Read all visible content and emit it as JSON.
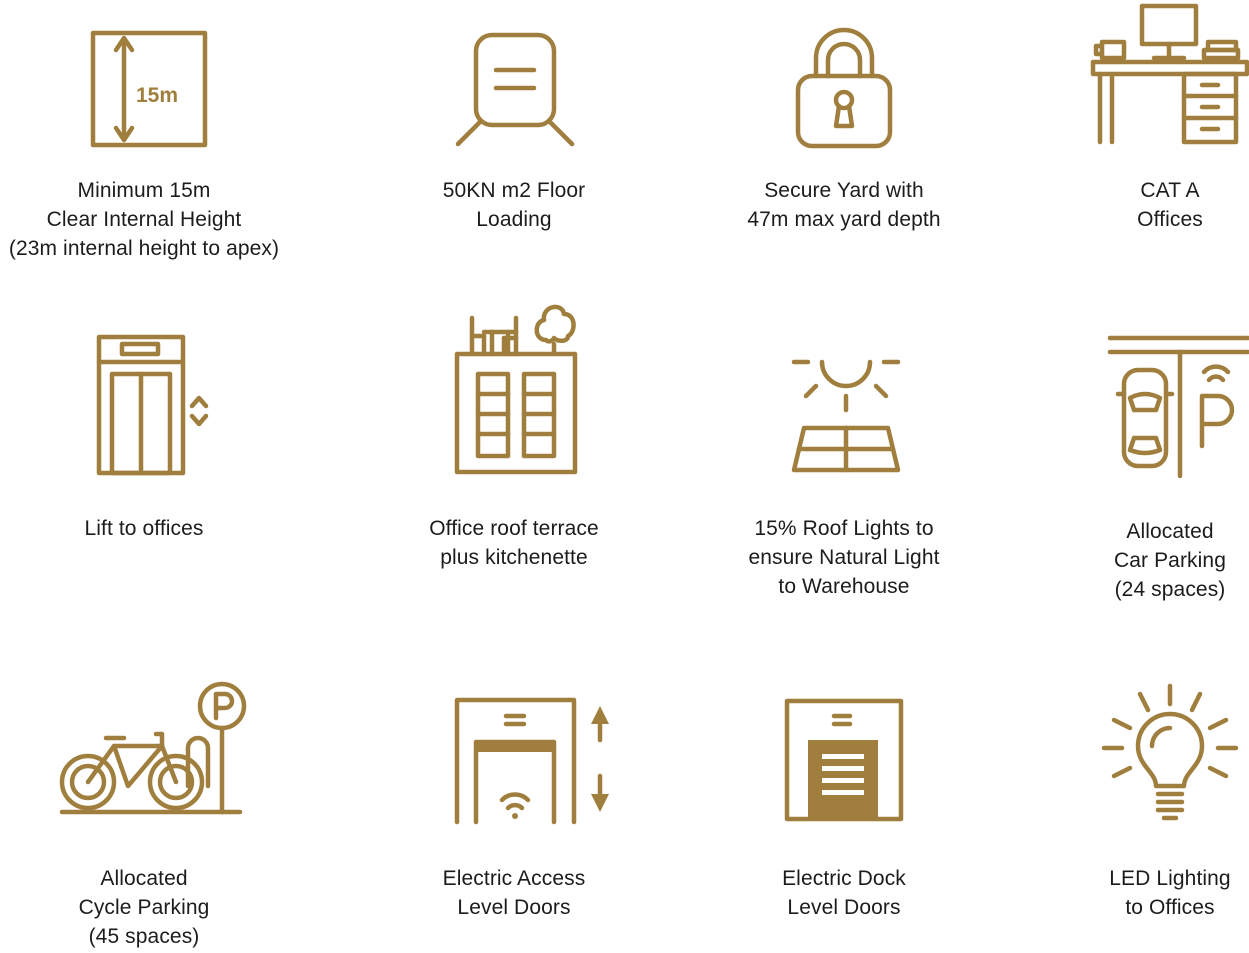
{
  "accent_color": "#a07f3e",
  "features": [
    {
      "icon": "ruler-height-icon",
      "icon_text": "15m",
      "lines": [
        "Minimum 15m",
        "Clear Internal Height",
        "(23m internal height to apex)"
      ]
    },
    {
      "icon": "floor-loading-icon",
      "lines": [
        "50KN m2 Floor",
        "Loading"
      ]
    },
    {
      "icon": "padlock-icon",
      "lines": [
        "Secure Yard with",
        "47m max yard depth"
      ]
    },
    {
      "icon": "office-desk-icon",
      "lines": [
        "CAT A",
        "Offices"
      ]
    },
    {
      "icon": "lift-icon",
      "lines": [
        "Lift to offices"
      ]
    },
    {
      "icon": "roof-terrace-icon",
      "lines": [
        "Office roof terrace",
        "plus kitchenette"
      ]
    },
    {
      "icon": "roof-light-icon",
      "lines": [
        "15% Roof Lights to",
        "ensure Natural Light",
        "to Warehouse"
      ]
    },
    {
      "icon": "car-parking-icon",
      "icon_text": "P",
      "lines": [
        "Allocated",
        "Car Parking",
        "(24 spaces)"
      ]
    },
    {
      "icon": "cycle-parking-icon",
      "icon_text": "P",
      "lines": [
        "Allocated",
        "Cycle Parking",
        "(45 spaces)"
      ]
    },
    {
      "icon": "electric-access-door-icon",
      "lines": [
        "Electric Access",
        "Level Doors"
      ]
    },
    {
      "icon": "electric-dock-door-icon",
      "lines": [
        "Electric Dock",
        "Level Doors"
      ]
    },
    {
      "icon": "led-bulb-icon",
      "lines": [
        "LED Lighting",
        "to Offices"
      ]
    }
  ]
}
